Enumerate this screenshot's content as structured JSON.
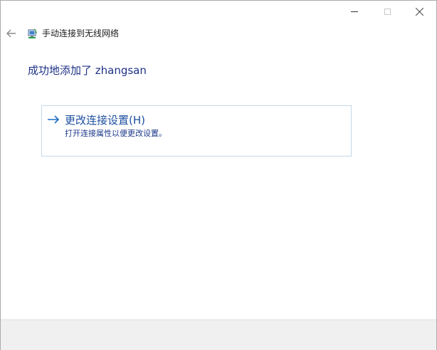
{
  "window": {
    "title": "手动连接到无线网络"
  },
  "main": {
    "heading": "成功地添加了 zhangsan"
  },
  "task": {
    "title": "更改连接设置(H)",
    "description": "打开连接属性以便更改设置。"
  },
  "icons": {
    "back": "back-arrow-icon",
    "wizard": "wireless-network-icon",
    "task": "right-arrow-icon",
    "minimize": "minimize-icon",
    "maximize": "maximize-icon",
    "close": "close-icon"
  },
  "colors": {
    "heading": "#1e3287",
    "link": "#1c4fa0",
    "task_border": "#c3d9ea",
    "footer_bg": "#f0f0f0"
  }
}
